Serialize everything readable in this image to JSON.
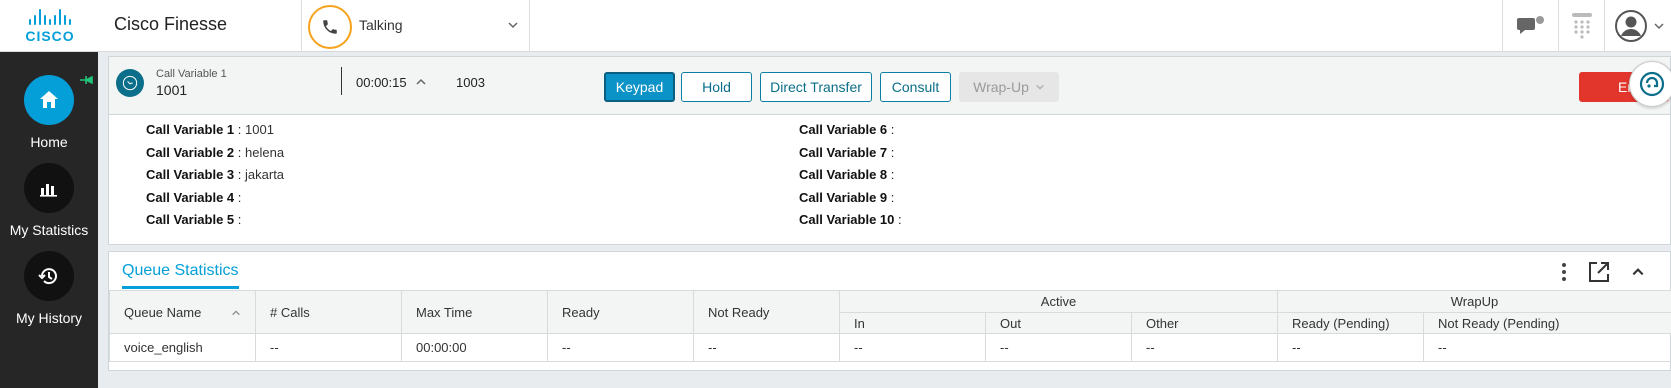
{
  "header": {
    "app_title": "Cisco Finesse",
    "logo_text": "CISCO",
    "agent_state": "Talking",
    "icons": [
      "phone-icon",
      "chevron-down-icon",
      "chat-icon",
      "dialpad-icon",
      "user-avatar-icon"
    ]
  },
  "nav": {
    "items": [
      {
        "label": "Home",
        "icon": "home-icon"
      },
      {
        "label": "My Statistics",
        "icon": "bar-chart-icon"
      },
      {
        "label": "My History",
        "icon": "history-icon"
      }
    ]
  },
  "call": {
    "variable_label": "Call Variable 1",
    "variable_value": "1001",
    "timer": "00:00:15",
    "ani": "1003",
    "buttons": {
      "keypad": "Keypad",
      "hold": "Hold",
      "direct_transfer": "Direct Transfer",
      "consult": "Consult",
      "wrapup": "Wrap-Up",
      "end": "End"
    },
    "variables_left": [
      {
        "name": "Call Variable 1",
        "value": "1001"
      },
      {
        "name": "Call Variable 2",
        "value": "helena"
      },
      {
        "name": "Call Variable 3",
        "value": "jakarta"
      },
      {
        "name": "Call Variable 4",
        "value": ""
      },
      {
        "name": "Call Variable 5",
        "value": ""
      }
    ],
    "variables_right": [
      {
        "name": "Call Variable 6",
        "value": ""
      },
      {
        "name": "Call Variable 7",
        "value": ""
      },
      {
        "name": "Call Variable 8",
        "value": ""
      },
      {
        "name": "Call Variable 9",
        "value": ""
      },
      {
        "name": "Call Variable 10",
        "value": ""
      }
    ]
  },
  "queue": {
    "title": "Queue Statistics",
    "group_active": "Active",
    "group_wrapup": "WrapUp",
    "columns": {
      "queue_name": "Queue Name",
      "calls": "# Calls",
      "max_time": "Max Time",
      "ready": "Ready",
      "not_ready": "Not Ready",
      "in": "In",
      "out": "Out",
      "other": "Other",
      "ready_pending": "Ready (Pending)",
      "not_ready_pending": "Not Ready (Pending)"
    },
    "rows": [
      [
        "voice_english",
        "--",
        "00:00:00",
        "--",
        "--",
        "--",
        "--",
        "--",
        "--",
        "--"
      ]
    ]
  },
  "colors": {
    "accent": "#049fd9",
    "talking": "#f7a21b",
    "end_button": "#e2362d",
    "nav_bg": "#262626"
  }
}
